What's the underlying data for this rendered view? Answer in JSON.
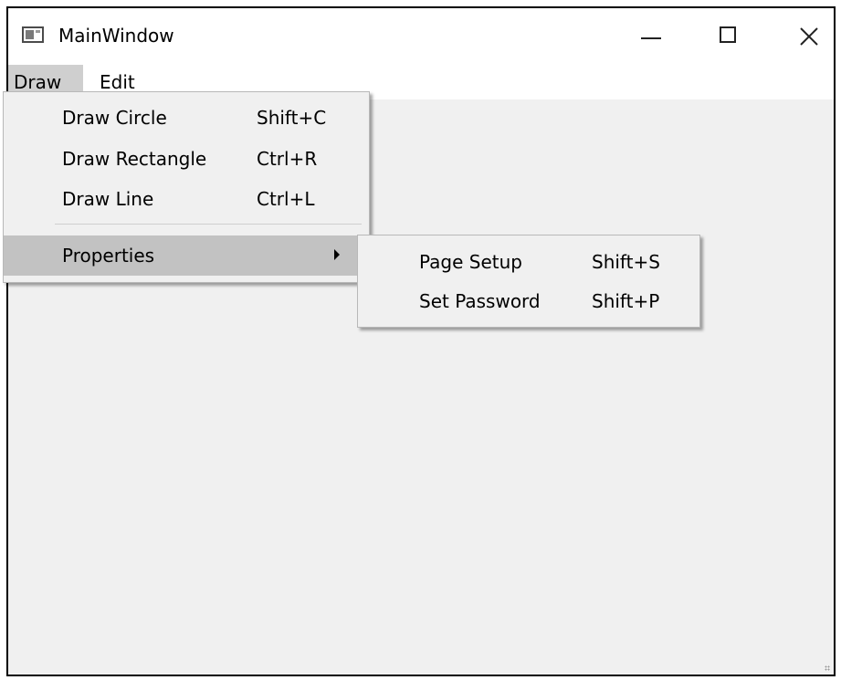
{
  "window": {
    "title": "MainWindow",
    "icons": {
      "app": "window-icon",
      "minimize": "minimize-icon",
      "maximize": "maximize-icon",
      "close": "close-icon"
    }
  },
  "menubar": {
    "items": [
      {
        "label": "Draw",
        "open": true
      },
      {
        "label": "Edit",
        "open": false
      }
    ]
  },
  "draw_menu": {
    "items": [
      {
        "label": "Draw Circle",
        "shortcut": "Shift+C"
      },
      {
        "label": "Draw Rectangle",
        "shortcut": "Ctrl+R"
      },
      {
        "label": "Draw Line",
        "shortcut": "Ctrl+L"
      }
    ],
    "submenu": {
      "label": "Properties",
      "highlighted": true
    }
  },
  "properties_menu": {
    "items": [
      {
        "label": "Page Setup",
        "shortcut": "Shift+S"
      },
      {
        "label": "Set Password",
        "shortcut": "Shift+P"
      }
    ]
  },
  "colors": {
    "menu_background": "#f0f0f0",
    "highlight": "#c2c2c2",
    "titlebar": "#ffffff"
  }
}
